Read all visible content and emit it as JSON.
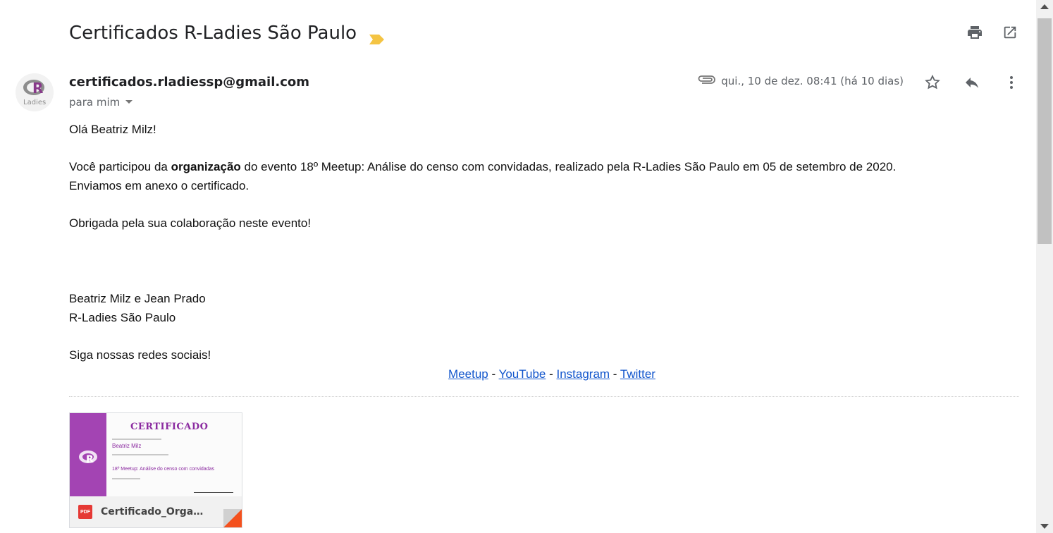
{
  "subject": "Certificados R-Ladies São Paulo",
  "toolbar": {
    "print_icon": "print-icon",
    "popout_icon": "open-in-new-window-icon"
  },
  "message": {
    "sender": "certificados.rladiessp@gmail.com",
    "recipient": "para mim",
    "date": "qui., 10 de dez. 08:41 (há 10 dias)",
    "avatar_text": "Ladies",
    "body": {
      "greeting": "Olá Beatriz Milz!",
      "p1_pre": "Você participou da ",
      "p1_bold": "organização",
      "p1_post": " do evento 18º Meetup: Análise do censo com convidadas, realizado pela R-Ladies São Paulo em 05 de setembro de 2020.",
      "p2": "Enviamos em anexo o certificado.",
      "p3": "Obrigada pela sua colaboração neste evento!",
      "sig1": "Beatriz Milz e Jean Prado",
      "sig2": "R-Ladies São Paulo",
      "social_intro": "Siga nossas redes sociais!",
      "links": [
        "Meetup",
        "YouTube",
        "Instagram",
        "Twitter"
      ],
      "sep": " - "
    }
  },
  "attachment": {
    "filename": "Certificado_Organi...",
    "type_badge": "PDF",
    "preview": {
      "title": "CERTIFICADO",
      "name": "Beatriz Milz",
      "event": "18º Meetup: Análise do censo com convidadas"
    }
  },
  "colors": {
    "accent": "#1155cc",
    "brand": "#a344b3",
    "important": "#f4c443"
  }
}
